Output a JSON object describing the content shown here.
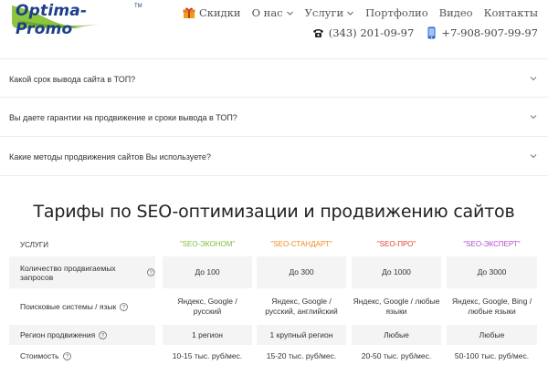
{
  "header": {
    "logo_text": "Optima-Promo",
    "logo_tm": "TM",
    "nav": [
      {
        "label": "Скидки"
      },
      {
        "label": "О нас"
      },
      {
        "label": "Услуги"
      },
      {
        "label": "Портфолио"
      },
      {
        "label": "Видео"
      },
      {
        "label": "Контакты"
      }
    ],
    "phone": "(343) 201-09-97",
    "mobile": "+7-908-907-99-97"
  },
  "faq": [
    {
      "question": "Какой срок вывода сайта в ТОП?"
    },
    {
      "question": "Вы даете гарантии на продвижение и сроки вывода в ТОП?"
    },
    {
      "question": "Какие методы продвижения сайтов Вы используете?"
    }
  ],
  "tariffs": {
    "title": "Тарифы по SEO-оптимизации и продвижению сайтов",
    "services_label": "УСЛУГИ",
    "plans": [
      {
        "name": "\"SEO-ЭКОНОМ\"",
        "color": "#7cbf3d"
      },
      {
        "name": "\"SEO-СТАНДАРТ\"",
        "color": "#f08a1c"
      },
      {
        "name": "\"SEO-ПРО\"",
        "color": "#e0432f"
      },
      {
        "name": "\"SEO-ЭКСПЕРТ\"",
        "color": "#b14bc8"
      }
    ],
    "rows": [
      {
        "label": "Количество продвигаемых запросов",
        "values": [
          "До 100",
          "До 300",
          "До 1000",
          "До 3000"
        ]
      },
      {
        "label": "Поисковые системы / язык",
        "values": [
          "Яндекс, Google / русский",
          "Яндекс, Google / русский, английский",
          "Яндекс, Google / любые языки",
          "Яндекс, Google, Bing / любые языки"
        ]
      },
      {
        "label": "Регион продвижения",
        "values": [
          "1 регион",
          "1 крупный регион",
          "Любые",
          "Любые"
        ]
      },
      {
        "label": "Стоимость",
        "values": [
          "10-15 тыс. руб/мес.",
          "15-20 тыс. руб/мес.",
          "20-50 тыс. руб/мес.",
          "50-100 тыс. руб/мес."
        ]
      }
    ]
  },
  "colors": {
    "logo_blue": "#1d3f8a",
    "logo_green": "#8cc63f",
    "gift_orange": "#f39c12",
    "mobile_blue": "#2a66c9"
  }
}
